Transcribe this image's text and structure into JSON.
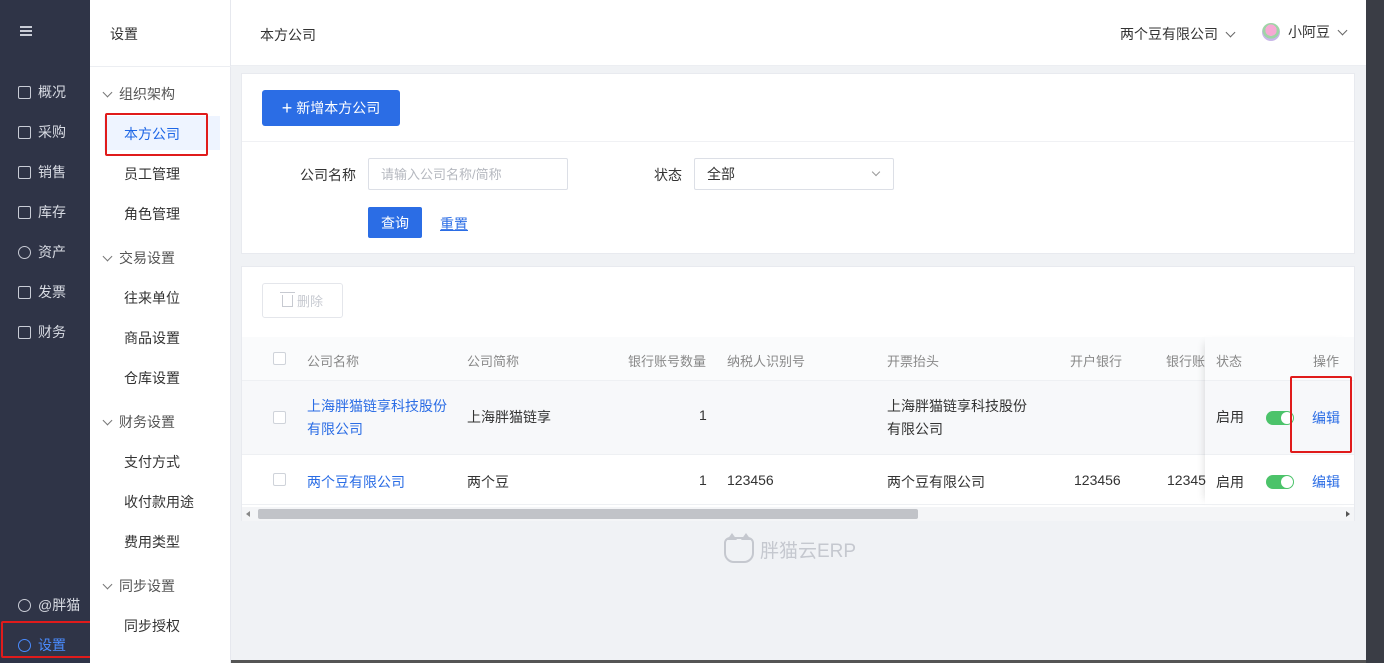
{
  "nav": {
    "items": [
      {
        "label": "概况",
        "icon": "overview-icon"
      },
      {
        "label": "采购",
        "icon": "purchase-icon"
      },
      {
        "label": "销售",
        "icon": "sales-icon"
      },
      {
        "label": "库存",
        "icon": "inventory-icon"
      },
      {
        "label": "资产",
        "icon": "asset-icon"
      },
      {
        "label": "发票",
        "icon": "invoice-icon"
      },
      {
        "label": "财务",
        "icon": "finance-icon"
      }
    ],
    "account": "@胖猫",
    "settings": "设置"
  },
  "submenu": {
    "title": "设置",
    "groups": [
      {
        "label": "组织架构",
        "links": [
          "本方公司",
          "员工管理",
          "角色管理"
        ]
      },
      {
        "label": "交易设置",
        "links": [
          "往来单位",
          "商品设置",
          "仓库设置"
        ]
      },
      {
        "label": "财务设置",
        "links": [
          "支付方式",
          "收付款用途",
          "费用类型"
        ]
      },
      {
        "label": "同步设置",
        "links": [
          "同步授权"
        ]
      }
    ],
    "active": "本方公司"
  },
  "topbar": {
    "title": "本方公司",
    "company": "两个豆有限公司",
    "user": "小阿豆"
  },
  "filter": {
    "add_button": "新增本方公司",
    "name_label": "公司名称",
    "name_placeholder": "请输入公司名称/简称",
    "status_label": "状态",
    "status_value": "全部",
    "query_button": "查询",
    "reset_button": "重置"
  },
  "table": {
    "delete_button": "删除",
    "columns": [
      "公司名称",
      "公司简称",
      "银行账号数量",
      "纳税人识别号",
      "开票抬头",
      "开户银行",
      "银行账",
      "状态",
      "操作"
    ],
    "rows": [
      {
        "name": "上海胖猫链享科技股份有限公司",
        "short": "上海胖猫链享",
        "accounts": "1",
        "tax_id": "",
        "invoice_title": "上海胖猫链享科技股份有限公司",
        "bank": "",
        "bank_account": "",
        "status": "启用",
        "action": "编辑"
      },
      {
        "name": "两个豆有限公司",
        "short": "两个豆",
        "accounts": "1",
        "tax_id": "123456",
        "invoice_title": "两个豆有限公司",
        "bank": "123456",
        "bank_account": "12345",
        "status": "启用",
        "action": "编辑"
      }
    ]
  },
  "brand": "胖猫云ERP",
  "colors": {
    "primary": "#2b6de5",
    "nav_bg": "#2f3447",
    "highlight": "#e01b1b",
    "switch_on": "#4cc36a"
  }
}
